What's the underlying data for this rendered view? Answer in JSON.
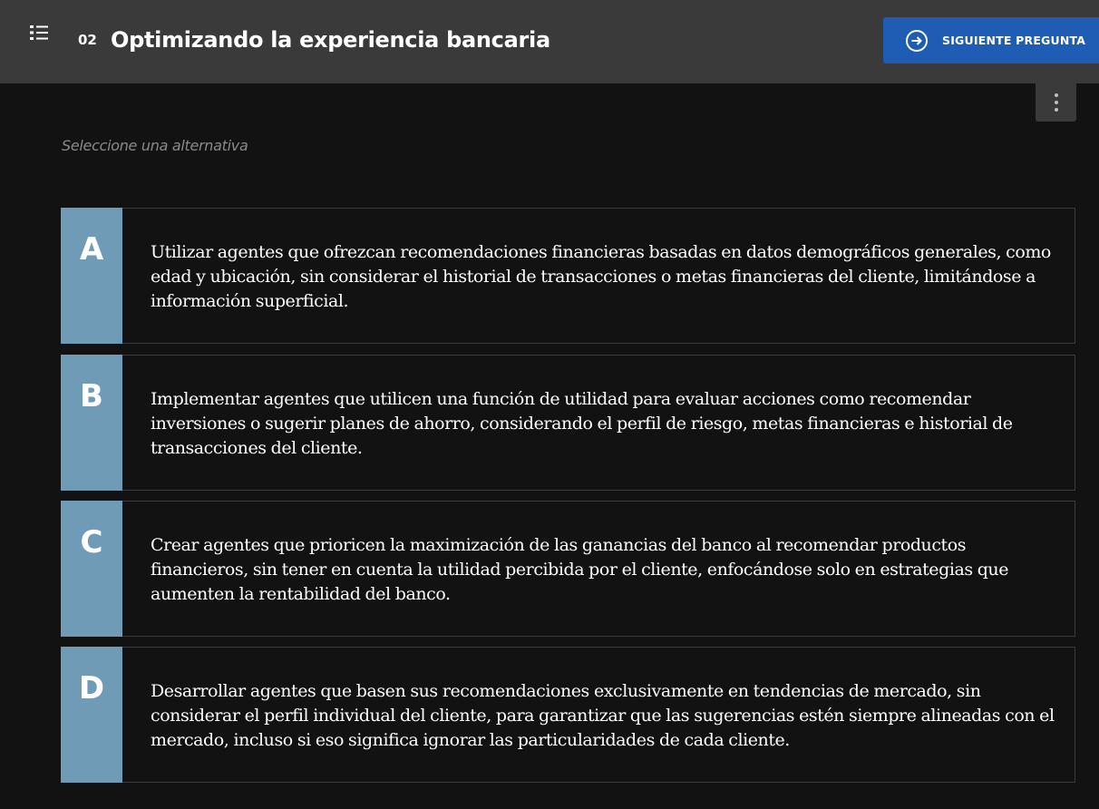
{
  "header": {
    "menu_icon": "list-icon",
    "question_number": "02",
    "title": "Optimizando la experiencia bancaria",
    "next_button_label": "SIGUIENTE PREGUNTA",
    "next_icon": "arrow-right-circle-icon",
    "more_icon": "more-vertical-icon"
  },
  "instruction": "Seleccione una alternativa",
  "options": [
    {
      "letter": "A",
      "text": "Utilizar agentes que ofrezcan recomendaciones financieras basadas en datos demográficos generales, como edad y ubicación, sin considerar el historial de transacciones o metas financieras del cliente, limitándose a información superficial."
    },
    {
      "letter": "B",
      "text": "Implementar agentes que utilicen una función de utilidad para evaluar acciones como recomendar inversiones o sugerir planes de ahorro, considerando el perfil de riesgo, metas financieras e historial de transacciones del cliente."
    },
    {
      "letter": "C",
      "text": "Crear agentes que prioricen la maximización de las ganancias del banco al recomendar productos financieros, sin tener en cuenta la utilidad percibida por el cliente, enfocándose solo en estrategias que aumenten la rentabilidad del banco."
    },
    {
      "letter": "D",
      "text": "Desarrollar agentes que basen sus recomendaciones exclusivamente en tendencias de mercado, sin considerar el perfil individual del cliente, para garantizar que las sugerencias estén siempre alineadas con el mercado, incluso si eso significa ignorar las particularidades de cada cliente."
    }
  ],
  "colors": {
    "background": "#121212",
    "header": "#3a3a3a",
    "primary_button": "#1f5db5",
    "letter_box": "#6f9bb6",
    "option_border": "#3c3c3c"
  }
}
